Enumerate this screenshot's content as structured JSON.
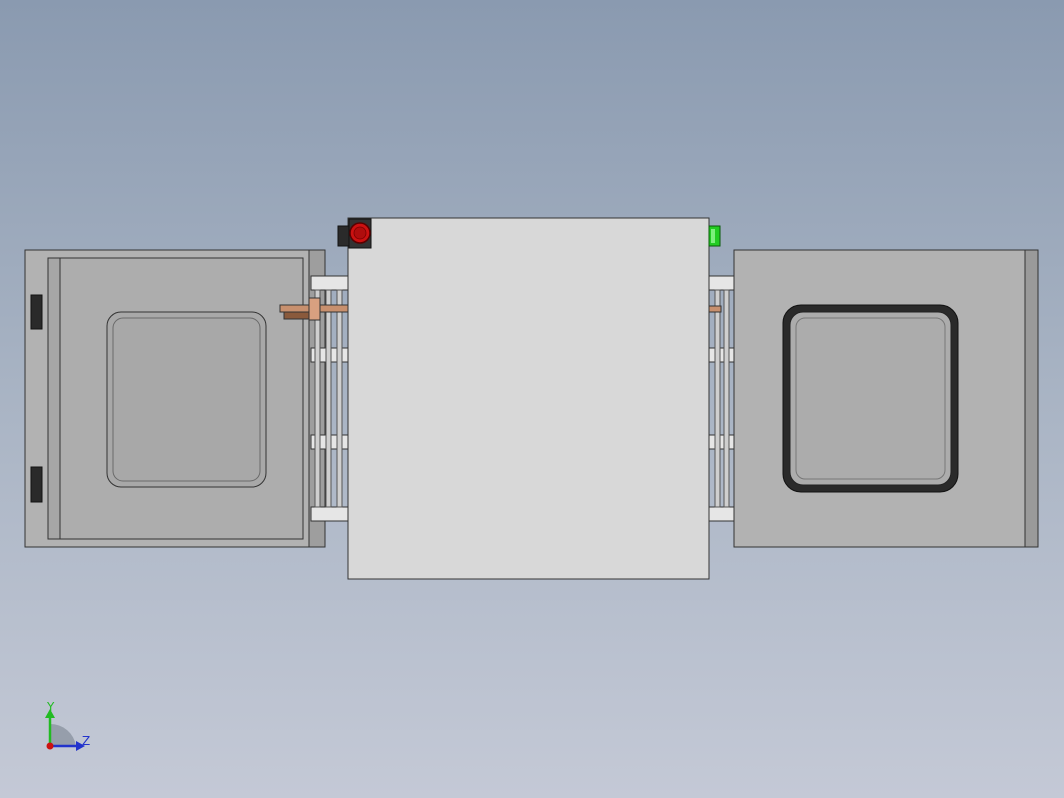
{
  "viewport": {
    "background_top": "#8a9ab0",
    "background_bottom": "#c4c9d6"
  },
  "model": {
    "body_color": "#d8d8d8",
    "door_color": "#b0b0b0",
    "window_color": "#a3a3a3",
    "red_button_color": "#cc1111",
    "green_light_color": "#22cc22",
    "hinge_color": "#c8906e"
  },
  "triad": {
    "y_label": "Y",
    "z_label": "Z",
    "y_color": "#22bb22",
    "z_color": "#2233cc",
    "origin_color": "#cc1111"
  }
}
